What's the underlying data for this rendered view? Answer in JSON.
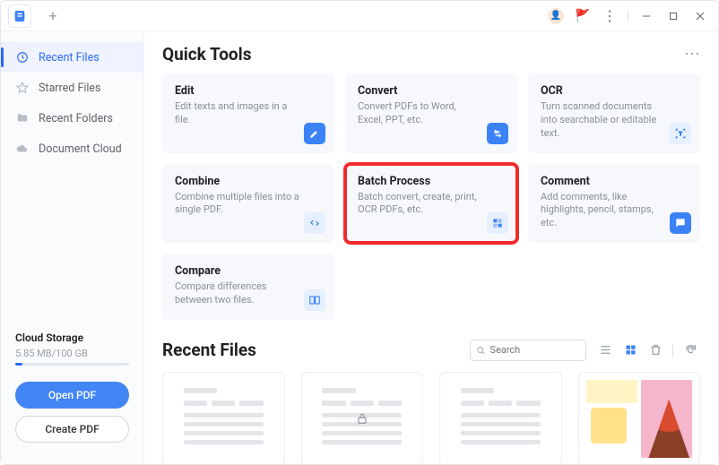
{
  "titlebar": {
    "newtab_tooltip": "New Tab"
  },
  "sidebar": {
    "items": [
      {
        "label": "Recent Files",
        "icon": "clock-icon"
      },
      {
        "label": "Starred Files",
        "icon": "star-icon"
      },
      {
        "label": "Recent Folders",
        "icon": "folder-icon"
      },
      {
        "label": "Document Cloud",
        "icon": "cloud-icon"
      }
    ],
    "active_index": 0,
    "cloud": {
      "title": "Cloud Storage",
      "usage": "5.85 MB/100 GB"
    },
    "open_btn": "Open PDF",
    "create_btn": "Create PDF"
  },
  "quick_tools": {
    "heading": "Quick Tools",
    "cards": [
      {
        "title": "Edit",
        "desc": "Edit texts and images in a file.",
        "icon": "edit-icon"
      },
      {
        "title": "Convert",
        "desc": "Convert PDFs to Word, Excel, PPT, etc.",
        "icon": "convert-icon"
      },
      {
        "title": "OCR",
        "desc": "Turn scanned documents into searchable or editable text.",
        "icon": "ocr-icon"
      },
      {
        "title": "Combine",
        "desc": "Combine multiple files into a single PDF.",
        "icon": "combine-icon"
      },
      {
        "title": "Batch Process",
        "desc": "Batch convert, create, print, OCR PDFs, etc.",
        "icon": "batch-icon"
      },
      {
        "title": "Comment",
        "desc": "Add comments, like highlights, pencil, stamps, etc.",
        "icon": "comment-icon"
      },
      {
        "title": "Compare",
        "desc": "Compare differences between two files.",
        "icon": "compare-icon"
      }
    ],
    "highlight_index": 4
  },
  "recent_files": {
    "heading": "Recent Files",
    "search_placeholder": "Search",
    "items": [
      {
        "type": "doc",
        "locked": false
      },
      {
        "type": "doc",
        "locked": true
      },
      {
        "type": "doc",
        "locked": false
      },
      {
        "type": "thumb",
        "locked": false
      }
    ]
  }
}
